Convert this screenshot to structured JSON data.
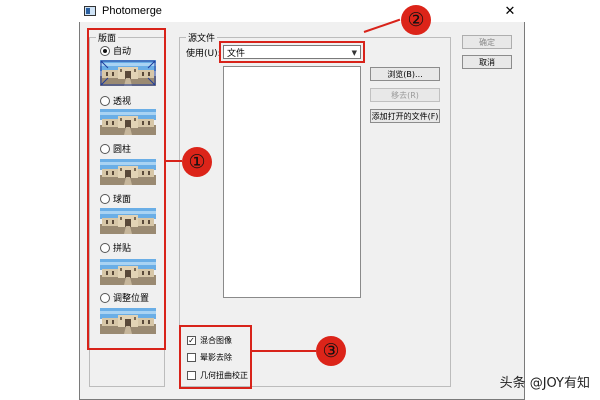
{
  "window": {
    "title": "Photomerge"
  },
  "layout_group": {
    "title": "版面",
    "options": [
      {
        "label": "自动",
        "selected": true
      },
      {
        "label": "透视",
        "selected": false
      },
      {
        "label": "圆柱",
        "selected": false
      },
      {
        "label": "球面",
        "selected": false
      },
      {
        "label": "拼贴",
        "selected": false
      },
      {
        "label": "调整位置",
        "selected": false
      }
    ]
  },
  "source_group": {
    "title": "源文件",
    "use_label": "使用(U):",
    "use_value": "文件",
    "browse": "浏览(B)...",
    "remove": "移去(R)",
    "add_open": "添加打开的文件(F)"
  },
  "actions": {
    "ok": "确定",
    "cancel": "取消"
  },
  "options": {
    "blend": {
      "label": "混合图像",
      "checked": true
    },
    "vignette": {
      "label": "晕影去除",
      "checked": false
    },
    "distortion": {
      "label": "几何扭曲校正",
      "checked": false
    }
  },
  "markers": [
    "①",
    "②",
    "③"
  ],
  "watermark": "头条 @JOY有知",
  "colors": {
    "annotation_red": "#d8231a",
    "marker_fill": "#dc2419"
  }
}
